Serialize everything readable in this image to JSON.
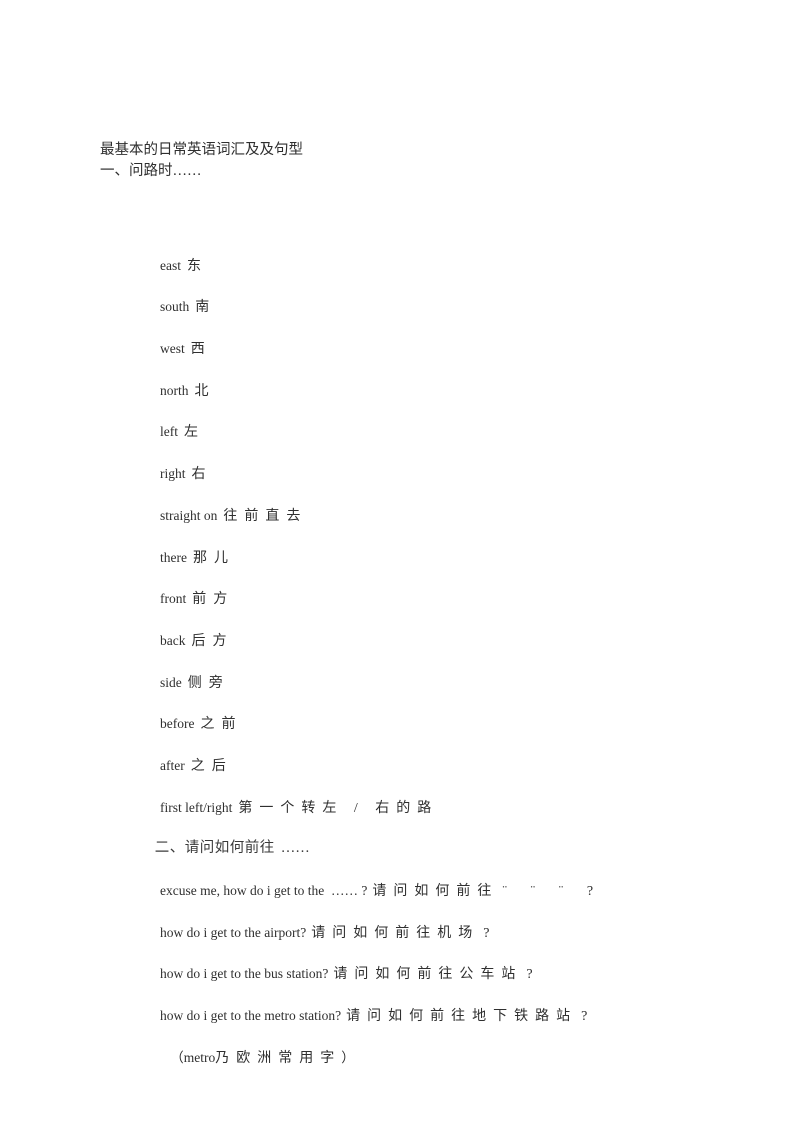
{
  "document": {
    "title_lines": [
      "最基本的日常英语词汇及及句型",
      "一、问路时……"
    ],
    "sections": [
      {
        "id": "directions-vocabulary",
        "heading": "一、问路时……",
        "items": [
          {
            "en": "east",
            "cn": "东"
          },
          {
            "en": "south",
            "cn": "南"
          },
          {
            "en": "west",
            "cn": "西"
          },
          {
            "en": "north",
            "cn": "北"
          },
          {
            "en": "left",
            "cn": "左"
          },
          {
            "en": "right",
            "cn": "右"
          },
          {
            "en": "straight on",
            "cn": "往前直去"
          },
          {
            "en": "there",
            "cn": "那儿"
          },
          {
            "en": "front",
            "cn": "前方"
          },
          {
            "en": "back",
            "cn": "后方"
          },
          {
            "en": "side",
            "cn": "侧旁"
          },
          {
            "en": "before",
            "cn": "之前"
          },
          {
            "en": "after",
            "cn": "之后"
          },
          {
            "en": "first left/right",
            "cn": "第一个转左 / 右的路"
          }
        ]
      },
      {
        "id": "asking-how-to-get-there",
        "heading_lead": "二、请问如何前往",
        "heading_dots": "……",
        "sentences": [
          {
            "en": "excuse me, how do i get to the  …… ?",
            "cn": "请问如何前往",
            "mark": "¨ ¨ ¨ ?"
          },
          {
            "en": "how do i get to the airport?",
            "cn": "请问如何前往机场",
            "mark": "?"
          },
          {
            "en": "how do i get to the bus station?",
            "cn": "请问如何前往公车站",
            "mark": "?"
          },
          {
            "en": "how do i get to the metro station?",
            "cn": "请问如何前往地下铁路站",
            "mark": "?"
          }
        ],
        "note": {
          "open": "（",
          "en": "metro",
          "cn": "乃欧洲常用字",
          "close": "）"
        }
      }
    ]
  }
}
